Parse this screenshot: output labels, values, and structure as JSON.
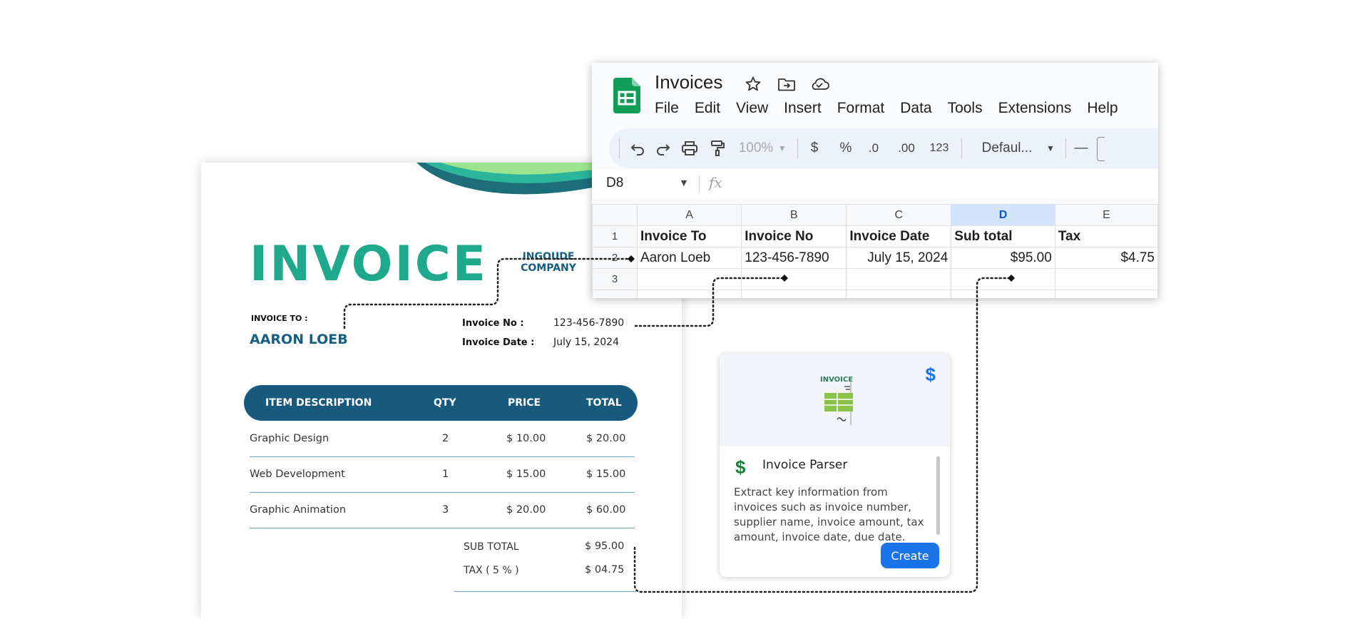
{
  "invoice": {
    "title": "INVOICE",
    "company": "INGOUDE COMPANY",
    "to_label": "INVOICE TO :",
    "to_name": "AARON LOEB",
    "no_label": "Invoice No :",
    "no_value": "123-456-7890",
    "date_label": "Invoice Date :",
    "date_value": "July 15, 2024",
    "table_headers": [
      "ITEM DESCRIPTION",
      "QTY",
      "PRICE",
      "TOTAL"
    ],
    "rows": [
      {
        "desc": "Graphic Design",
        "qty": "2",
        "price": "$ 10.00",
        "total": "$ 20.00"
      },
      {
        "desc": "Web Development",
        "qty": "1",
        "price": "$ 15.00",
        "total": "$ 15.00"
      },
      {
        "desc": "Graphic Animation",
        "qty": "3",
        "price": "$ 20.00",
        "total": "$ 60.00"
      }
    ],
    "subtotal_label": "SUB TOTAL",
    "subtotal_value": "$ 95.00",
    "tax_label": "TAX ( 5 % )",
    "tax_value": "$ 04.75",
    "colors": {
      "title": "#1fa98c",
      "accent": "#175a7e"
    }
  },
  "sheets": {
    "doc_title": "Invoices",
    "menu": [
      "File",
      "Edit",
      "View",
      "Insert",
      "Format",
      "Data",
      "Tools",
      "Extensions",
      "Help"
    ],
    "toolbar": {
      "zoom": "100%",
      "currency": "$",
      "percent": "%",
      "dec_decrease": ".0",
      "dec_increase": ".00",
      "number_format": "123",
      "font": "Defaul...",
      "minus": "—"
    },
    "name_box": "D8",
    "fx_label": "fx",
    "columns": [
      "A",
      "B",
      "C",
      "D",
      "E"
    ],
    "selected_column": "D",
    "rows": [
      {
        "num": "1",
        "cells": [
          "Invoice To",
          "Invoice No",
          "Invoice Date",
          "Sub total",
          "Tax"
        ]
      },
      {
        "num": "2",
        "cells": [
          "Aaron Loeb",
          "123-456-7890",
          "July 15, 2024",
          "$95.00",
          "$4.75"
        ]
      },
      {
        "num": "3",
        "cells": [
          "",
          "",
          "",
          "",
          ""
        ]
      }
    ],
    "colors": {
      "logo": "#0f9d58",
      "selected_header": "#d3e3fd"
    }
  },
  "addon": {
    "preview_label": "INVOICE",
    "top_icon": "$",
    "icon": "$",
    "name": "Invoice Parser",
    "description": "Extract key information from invoices such as invoice number, supplier name, invoice amount, tax amount, invoice date, due date.",
    "button": "Create",
    "colors": {
      "button": "#1a73e8",
      "icon": "#188038"
    }
  }
}
